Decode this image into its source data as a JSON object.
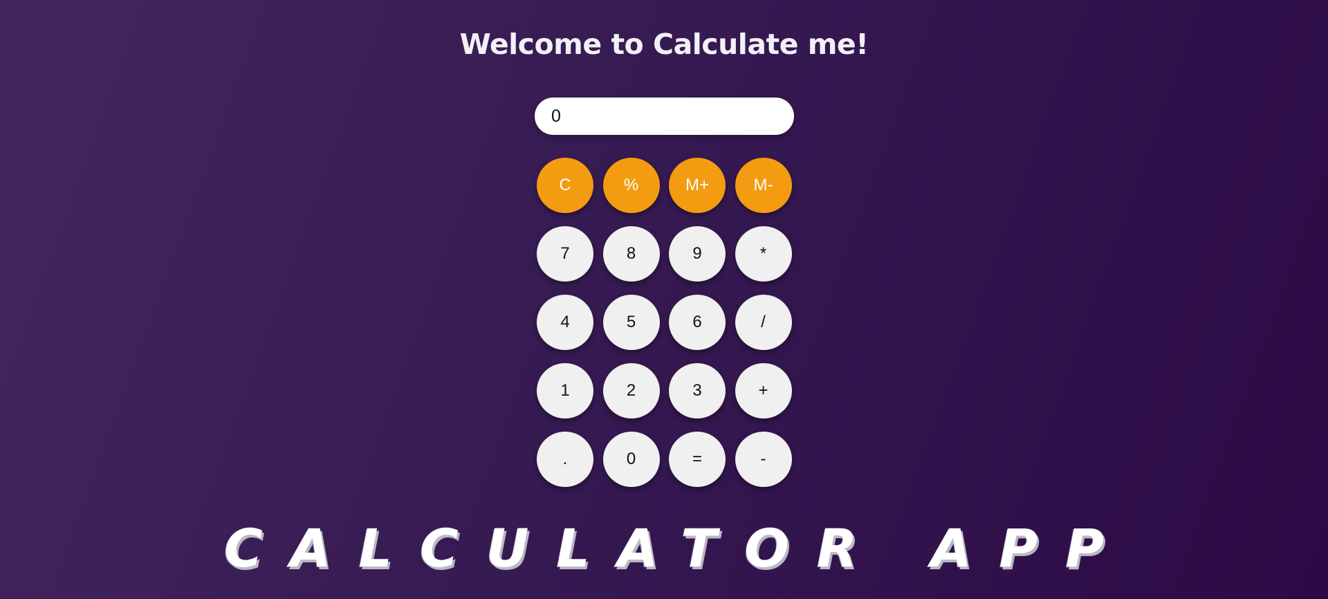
{
  "header": {
    "title": "Welcome to Calculate me!"
  },
  "display": {
    "value": "0"
  },
  "keys": [
    {
      "label": "C",
      "name": "clear-button",
      "kind": "op"
    },
    {
      "label": "%",
      "name": "percent-button",
      "kind": "op"
    },
    {
      "label": "M+",
      "name": "memory-add-button",
      "kind": "op"
    },
    {
      "label": "M-",
      "name": "memory-subtract-button",
      "kind": "op"
    },
    {
      "label": "7",
      "name": "digit-7-button",
      "kind": "num"
    },
    {
      "label": "8",
      "name": "digit-8-button",
      "kind": "num"
    },
    {
      "label": "9",
      "name": "digit-9-button",
      "kind": "num"
    },
    {
      "label": "*",
      "name": "multiply-button",
      "kind": "num"
    },
    {
      "label": "4",
      "name": "digit-4-button",
      "kind": "num"
    },
    {
      "label": "5",
      "name": "digit-5-button",
      "kind": "num"
    },
    {
      "label": "6",
      "name": "digit-6-button",
      "kind": "num"
    },
    {
      "label": "/",
      "name": "divide-button",
      "kind": "num"
    },
    {
      "label": "1",
      "name": "digit-1-button",
      "kind": "num"
    },
    {
      "label": "2",
      "name": "digit-2-button",
      "kind": "num"
    },
    {
      "label": "3",
      "name": "digit-3-button",
      "kind": "num"
    },
    {
      "label": "+",
      "name": "add-button",
      "kind": "num"
    },
    {
      "label": ".",
      "name": "decimal-button",
      "kind": "num"
    },
    {
      "label": "0",
      "name": "digit-0-button",
      "kind": "num"
    },
    {
      "label": "=",
      "name": "equals-button",
      "kind": "num"
    },
    {
      "label": "-",
      "name": "subtract-button",
      "kind": "num"
    }
  ],
  "footer": {
    "brand": "CALCULATOR APP"
  },
  "colors": {
    "accent": "#f39c12",
    "key_light": "#f0f0f0",
    "background_start": "#42265c",
    "background_end": "#2c0a45"
  }
}
